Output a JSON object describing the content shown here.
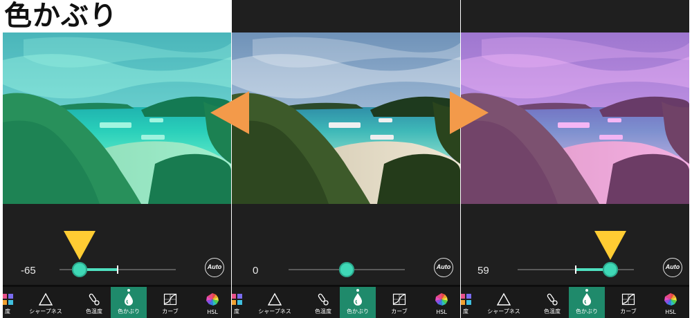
{
  "page_title": "色かぶり",
  "accent_color": "#3fd8b6",
  "active_tool_color": "#1f8a6b",
  "marker_color": "#ffcc33",
  "arrow_color": "#f39a4a",
  "panels": [
    {
      "value": "-65",
      "slider_fraction": 0.17,
      "auto_label": "Auto",
      "marker": true,
      "tint": "cyan",
      "tools": [
        {
          "label": "度",
          "icon": "palette-icon"
        },
        {
          "label": "シャープネス",
          "icon": "triangle-icon"
        },
        {
          "label": "色温度",
          "icon": "thermometer-icon"
        },
        {
          "label": "色かぶり",
          "icon": "drop-icon",
          "active": true
        },
        {
          "label": "カーブ",
          "icon": "curve-icon"
        },
        {
          "label": "HSL",
          "icon": "color-wheel-icon"
        }
      ]
    },
    {
      "value": "0",
      "slider_fraction": 0.5,
      "auto_label": "Auto",
      "marker": false,
      "tint": "none",
      "tools": [
        {
          "label": "度",
          "icon": "palette-icon"
        },
        {
          "label": "シャープネス",
          "icon": "triangle-icon"
        },
        {
          "label": "色温度",
          "icon": "thermometer-icon"
        },
        {
          "label": "色かぶり",
          "icon": "drop-icon",
          "active": true
        },
        {
          "label": "カーブ",
          "icon": "curve-icon"
        },
        {
          "label": "HSL",
          "icon": "color-wheel-icon"
        }
      ]
    },
    {
      "value": "59",
      "slider_fraction": 0.795,
      "auto_label": "Auto",
      "marker": true,
      "tint": "magenta",
      "tools": [
        {
          "label": "度",
          "icon": "palette-icon"
        },
        {
          "label": "シャープネス",
          "icon": "triangle-icon"
        },
        {
          "label": "色温度",
          "icon": "thermometer-icon"
        },
        {
          "label": "色かぶり",
          "icon": "drop-icon",
          "active": true
        },
        {
          "label": "カーブ",
          "icon": "curve-icon"
        },
        {
          "label": "HSL",
          "icon": "color-wheel-icon"
        }
      ]
    }
  ]
}
